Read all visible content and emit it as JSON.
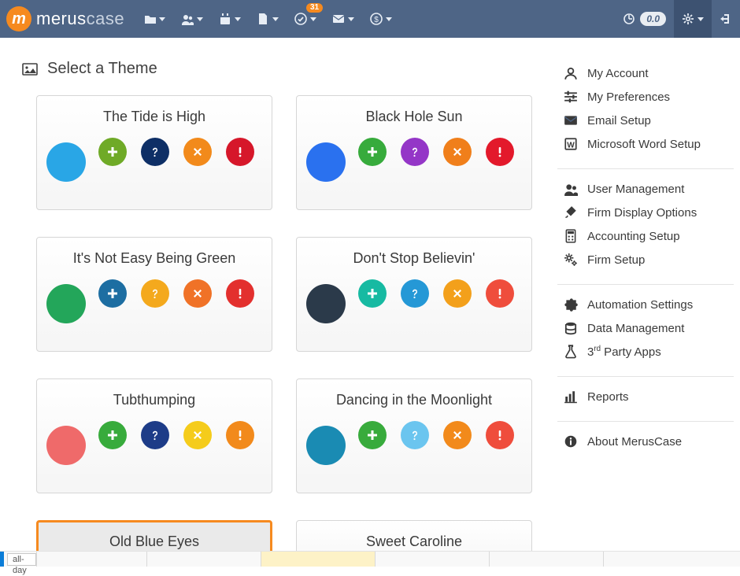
{
  "app": {
    "logo_initial": "m",
    "brand_bold": "merus",
    "brand_light": "case"
  },
  "topbar": {
    "notifications_count": "31",
    "balance": "0.0"
  },
  "page": {
    "title": "Select a Theme"
  },
  "themes": [
    {
      "name": "The Tide is High",
      "primary": "#29a6e6",
      "swatches": [
        [
          "#6faa27",
          "plus"
        ],
        [
          "#0e2f66",
          "question"
        ],
        [
          "#f28a1b",
          "times"
        ],
        [
          "#d6172a",
          "exclaim"
        ]
      ],
      "selected": false
    },
    {
      "name": "Black Hole Sun",
      "primary": "#2a71ef",
      "swatches": [
        [
          "#37ab3c",
          "plus"
        ],
        [
          "#9436c7",
          "question"
        ],
        [
          "#f07f1b",
          "times"
        ],
        [
          "#e3192b",
          "exclaim"
        ]
      ],
      "selected": false
    },
    {
      "name": "It's Not Easy Being Green",
      "primary": "#23a65a",
      "swatches": [
        [
          "#1d6ea2",
          "plus"
        ],
        [
          "#f4a91d",
          "question"
        ],
        [
          "#f07227",
          "times"
        ],
        [
          "#e3302e",
          "exclaim"
        ]
      ],
      "selected": false
    },
    {
      "name": "Don't Stop Believin'",
      "primary": "#2b3a4a",
      "swatches": [
        [
          "#17baa2",
          "plus"
        ],
        [
          "#2598d6",
          "question"
        ],
        [
          "#f3a01b",
          "times"
        ],
        [
          "#ef4d3c",
          "exclaim"
        ]
      ],
      "selected": false
    },
    {
      "name": "Tubthumping",
      "primary": "#ef6a6a",
      "swatches": [
        [
          "#38ab3c",
          "plus"
        ],
        [
          "#1d3c88",
          "question"
        ],
        [
          "#f5cc1b",
          "times"
        ],
        [
          "#f28a1b",
          "exclaim"
        ]
      ],
      "selected": false
    },
    {
      "name": "Dancing in the Moonlight",
      "primary": "#1a8bb3",
      "swatches": [
        [
          "#38ab3c",
          "plus"
        ],
        [
          "#6bc5ef",
          "question"
        ],
        [
          "#f28a1b",
          "times"
        ],
        [
          "#ef4d3c",
          "exclaim"
        ]
      ],
      "selected": false
    },
    {
      "name": "Old Blue Eyes",
      "primary": "#2e78c2",
      "swatches": [],
      "selected": true,
      "cut": true
    },
    {
      "name": "Sweet Caroline",
      "primary": "#c0486f",
      "swatches": [],
      "selected": false,
      "cut": true
    }
  ],
  "sidebar": {
    "sections": [
      [
        {
          "icon": "user",
          "label": "My Account"
        },
        {
          "icon": "sliders",
          "label": "My Preferences"
        },
        {
          "icon": "envelope",
          "label": "Email Setup"
        },
        {
          "icon": "word",
          "label": "Microsoft Word Setup"
        }
      ],
      [
        {
          "icon": "users",
          "label": "User Management"
        },
        {
          "icon": "brush",
          "label": "Firm Display Options"
        },
        {
          "icon": "calc",
          "label": "Accounting Setup"
        },
        {
          "icon": "cogs",
          "label": "Firm Setup"
        }
      ],
      [
        {
          "icon": "puzzle",
          "label": "Automation Settings"
        },
        {
          "icon": "db",
          "label": "Data Management"
        },
        {
          "icon": "flask",
          "label_prefix": "3",
          "label_sup": "rd",
          "label_suffix": " Party Apps"
        }
      ],
      [
        {
          "icon": "chart",
          "label": "Reports"
        }
      ],
      [
        {
          "icon": "info",
          "label": "About MerusCase"
        }
      ]
    ]
  },
  "footer": {
    "allday_label": "all-day"
  }
}
